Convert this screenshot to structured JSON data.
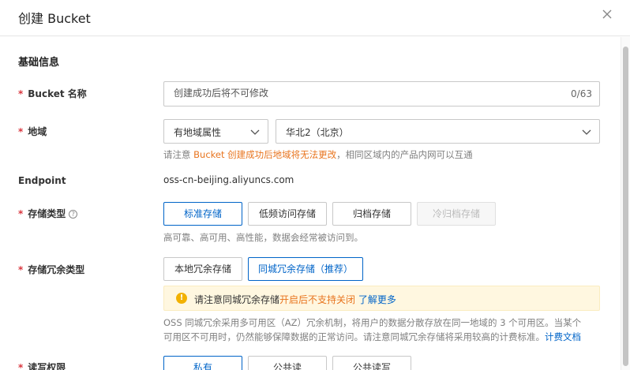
{
  "dialog": {
    "title": "创建 Bucket"
  },
  "section": {
    "title": "基础信息"
  },
  "bucket_name": {
    "label": "Bucket 名称",
    "placeholder": "创建成功后将不可修改",
    "counter": "0/63"
  },
  "region": {
    "label": "地域",
    "type_value": "有地域属性",
    "region_value": "华北2（北京）",
    "hint_prefix": "请注意 ",
    "hint_warn": "Bucket 创建成功后地域将无法更改",
    "hint_suffix": "，相同区域内的产品内网可以互通"
  },
  "endpoint": {
    "label": "Endpoint",
    "value": "oss-cn-beijing.aliyuncs.com"
  },
  "storage_class": {
    "label": "存储类型",
    "options": [
      "标准存储",
      "低频访问存储",
      "归档存储",
      "冷归档存储"
    ],
    "selected": "标准存储",
    "hint": "高可靠、高可用、高性能，数据会经常被访问到。"
  },
  "redundancy": {
    "label": "存储冗余类型",
    "options": [
      "本地冗余存储",
      "同城冗余存储（推荐）"
    ],
    "selected": "同城冗余存储（推荐）",
    "notice_prefix": "请注意同城冗余存储",
    "notice_warn": "开启后不支持关闭",
    "notice_link": "了解更多",
    "desc_line1": "OSS 同城冗余采用多可用区（AZ）冗余机制，将用户的数据分散存放在同一地域的 3 个可用区。当某个",
    "desc_line2": "可用区不可用时，仍然能够保障数据的正常访问。请注意同城冗余存储将采用较高的计费标准。",
    "desc_link": "计费文档"
  },
  "acl": {
    "label": "读写权限",
    "options": [
      "私有",
      "公共读",
      "公共读写"
    ],
    "selected": "私有"
  },
  "colors": {
    "primary": "#0064c8",
    "warning": "#e8741e",
    "required": "#d9363e",
    "notice_bg": "#fff7e0"
  }
}
